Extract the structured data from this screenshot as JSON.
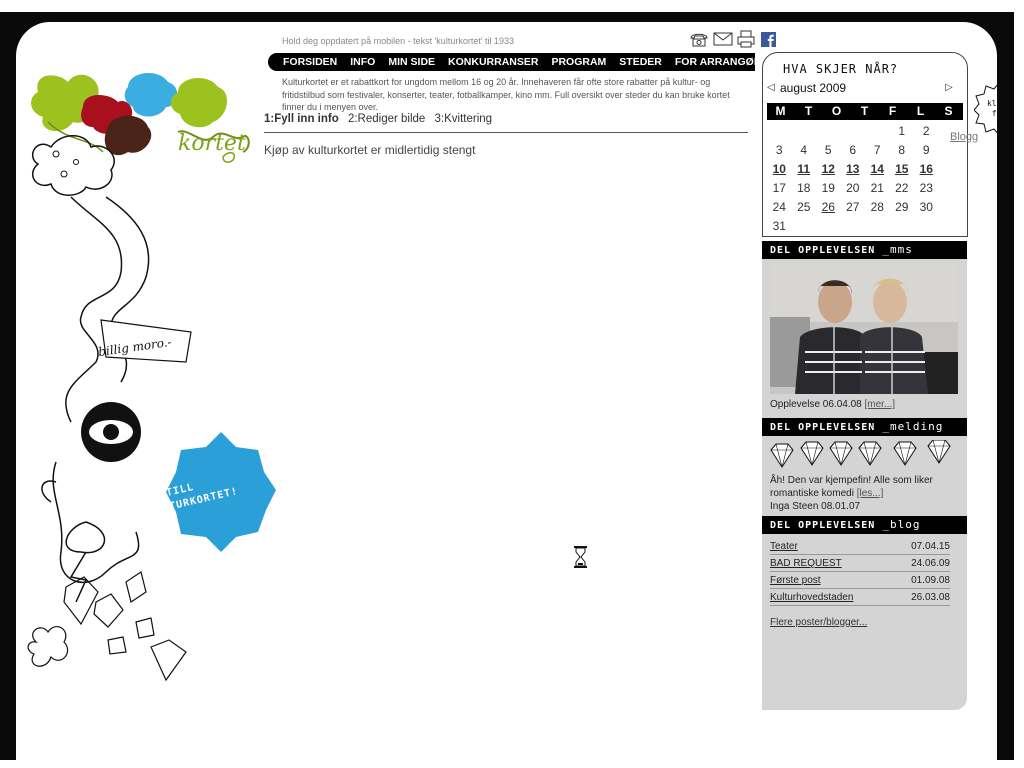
{
  "top": {
    "sms_tip": "Hold deg oppdatert på mobilen - tekst 'kulturkortet' til 1933",
    "icons": [
      "phone-icon",
      "mail-icon",
      "print-icon",
      "facebook-icon"
    ]
  },
  "nav": {
    "items": [
      "FORSIDEN",
      "INFO",
      "MIN SIDE",
      "KONKURRANSER",
      "PROGRAM",
      "STEDER",
      "FOR ARRANGØRER"
    ]
  },
  "intro": "Kulturkortet er et rabattkort for ungdom mellom 16 og 20 år. Innehaveren får ofte store rabatter på kultur- og fritidstilbud som festivaler, konserter, teater, fotballkamper, kino mm. Full oversikt over steder du kan bruke kortet finner du i menyen over.",
  "steps": [
    "1:Fyll inn info",
    "2:Rediger bilde",
    "3:Kvittering"
  ],
  "closed_message": "Kjøp av kulturkortet er midlertidig stengt",
  "left": {
    "bestill": "BESTILL KULTURKORTET!",
    "billig": "billig moro.-"
  },
  "calendar": {
    "title": "HVA SKJER NÅR?",
    "month": "august 2009",
    "weekdays": [
      "M",
      "T",
      "O",
      "T",
      "F",
      "L",
      "S"
    ],
    "rows": [
      [
        "",
        "",
        "",
        "",
        "",
        "1",
        "2"
      ],
      [
        "3",
        "4",
        "5",
        "6",
        "7",
        "8",
        "9"
      ],
      [
        "10",
        "11",
        "12",
        "13",
        "14",
        "15",
        "16"
      ],
      [
        "17",
        "18",
        "19",
        "20",
        "21",
        "22",
        "23"
      ],
      [
        "24",
        "25",
        "26",
        "27",
        "28",
        "29",
        "30"
      ],
      [
        "31",
        "",
        "",
        "",
        "",
        "",
        ""
      ]
    ],
    "event_days": [
      "10",
      "11",
      "12",
      "13",
      "14",
      "15",
      "16"
    ],
    "underlined_days": [
      "26"
    ]
  },
  "sections": {
    "mms": {
      "label": "DEL OPPLEVELSEN",
      "suffix": "_mms"
    },
    "melding": {
      "label": "DEL OPPLEVELSEN",
      "suffix": "_melding"
    },
    "blog": {
      "label": "DEL OPPLEVELSEN",
      "suffix": "_blog"
    }
  },
  "mms": {
    "caption": "Opplevelse 06.04.08",
    "more": "[mer...]"
  },
  "melding": {
    "text": "Åh! Den var kjempefin! Alle som liker romantiske komedi",
    "more": "[les...]",
    "author": "Inga Steen 08.01.07"
  },
  "blog": {
    "posts": [
      {
        "title": "Teater",
        "date": "07.04.15"
      },
      {
        "title": "BAD REQUEST",
        "date": "24.06.09"
      },
      {
        "title": "Første post",
        "date": "01.09.08"
      },
      {
        "title": "Kulturhovedstaden",
        "date": "26.03.08"
      }
    ],
    "more": "Flere poster/blogger..."
  },
  "klikk": {
    "line1": "klikk",
    "line2": "for"
  },
  "blogg_link": "Blogg"
}
